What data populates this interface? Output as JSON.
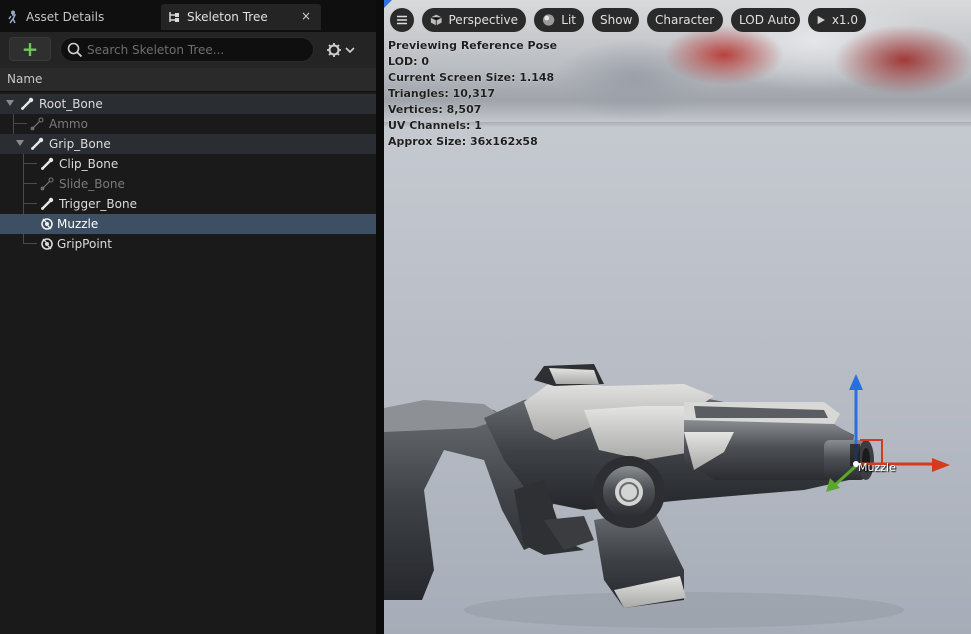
{
  "tabs": {
    "asset_details": "Asset Details",
    "skeleton_tree": "Skeleton Tree",
    "close": "×"
  },
  "toolbar": {
    "add_label": "+",
    "search_placeholder": "Search Skeleton Tree..."
  },
  "column_header": "Name",
  "tree": {
    "root_bone": "Root_Bone",
    "ammo": "Ammo",
    "grip_bone": "Grip_Bone",
    "clip_bone": "Clip_Bone",
    "slide_bone": "Slide_Bone",
    "trigger_bone": "Trigger_Bone",
    "muzzle": "Muzzle",
    "grip_point": "GripPoint"
  },
  "viewport": {
    "buttons": {
      "perspective": "Perspective",
      "lit": "Lit",
      "show": "Show",
      "character": "Character",
      "lod": "LOD Auto",
      "speed": "x1.0"
    },
    "stats": [
      "Previewing Reference Pose",
      "LOD: 0",
      "Current Screen Size: 1.148",
      "Triangles: 10,317",
      "Vertices: 8,507",
      "UV Channels: 1",
      "Approx Size: 36x162x58"
    ],
    "socket_label": "Muzzle"
  },
  "colors": {
    "accent_green": "#6ec85a",
    "selection": "#3c4f63",
    "gizmo_x": "#d43a1e",
    "gizmo_y": "#5aa82a",
    "gizmo_z": "#2a6fe0"
  }
}
